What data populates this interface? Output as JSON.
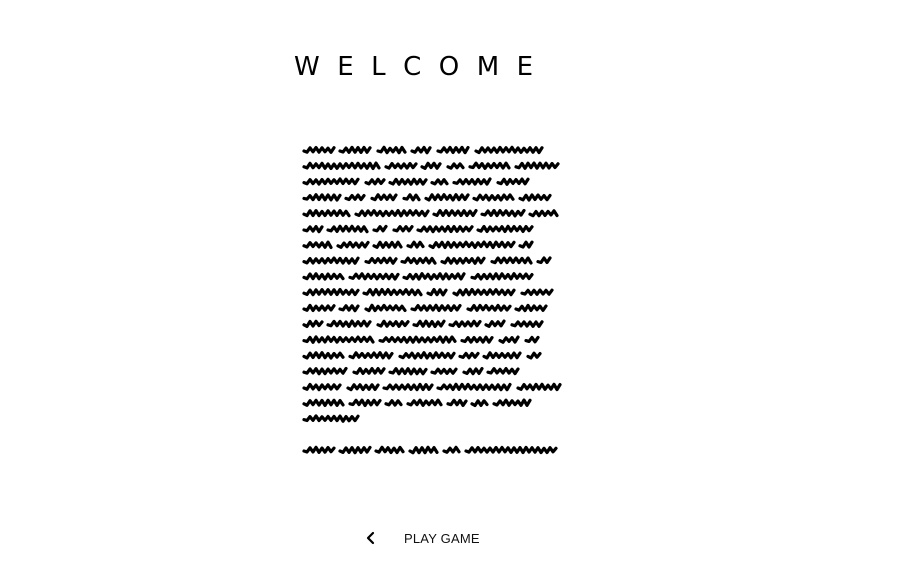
{
  "screen": {
    "title": "WELCOME",
    "body_text_legible": false,
    "text_color": "#000000",
    "background_color": "#ffffff"
  },
  "navigation": {
    "back_icon": "chevron-left-icon",
    "play_label": "PLAY GAME"
  }
}
